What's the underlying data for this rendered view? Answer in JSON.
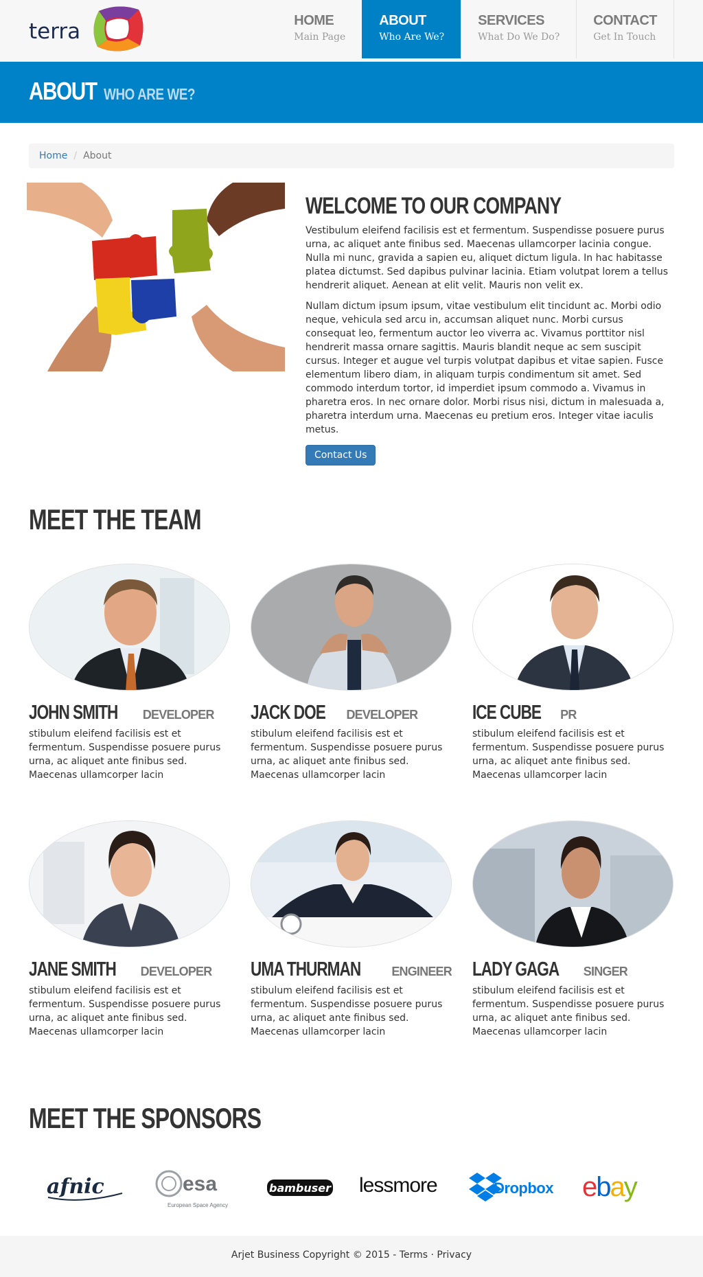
{
  "brand": {
    "logo_text": "terra"
  },
  "nav": [
    {
      "title": "HOME",
      "sub": "Main Page"
    },
    {
      "title": "ABOUT",
      "sub": "Who Are We?"
    },
    {
      "title": "SERVICES",
      "sub": "What Do We Do?"
    },
    {
      "title": "CONTACT",
      "sub": "Get In Touch"
    }
  ],
  "banner": {
    "title": "ABOUT",
    "subtitle": "WHO ARE WE?"
  },
  "breadcrumb": {
    "home": "Home",
    "separator": "/",
    "current": "About"
  },
  "about": {
    "title": "WELCOME TO OUR COMPANY",
    "p1": "Vestibulum eleifend facilisis est et fermentum. Suspendisse posuere purus urna, ac aliquet ante finibus sed. Maecenas ullamcorper lacinia congue. Nulla mi nunc, gravida a sapien eu, aliquet dictum ligula. In hac habitasse platea dictumst. Sed dapibus pulvinar lacinia. Etiam volutpat lorem a tellus hendrerit aliquet. Aenean at elit velit. Mauris non velit ex.",
    "p2": "Nullam dictum ipsum ipsum, vitae vestibulum elit tincidunt ac. Morbi odio neque, vehicula sed arcu in, accumsan aliquet nunc. Morbi cursus consequat leo, fermentum auctor leo viverra ac. Vivamus porttitor nisl hendrerit massa ornare sagittis. Mauris blandit neque ac sem suscipit cursus. Integer et augue vel turpis volutpat dapibus et vitae sapien. Fusce elementum libero diam, in aliquam turpis condimentum sit amet. Sed commodo interdum tortor, id imperdiet ipsum commodo a. Vivamus in pharetra eros. In nec ornare dolor. Morbi risus nisi, dictum in malesuada a, pharetra interdum urna. Maecenas eu pretium eros. Integer vitae iaculis metus.",
    "button": "Contact Us"
  },
  "team": {
    "title": "MEET THE TEAM",
    "members": [
      {
        "name": "JOHN SMITH",
        "role": "DEVELOPER",
        "desc": "stibulum eleifend facilisis est et fermentum. Suspendisse posuere purus urna, ac aliquet ante finibus sed. Maecenas ullamcorper lacin"
      },
      {
        "name": "JACK DOE",
        "role": "DEVELOPER",
        "desc": "stibulum eleifend facilisis est et fermentum. Suspendisse posuere purus urna, ac aliquet ante finibus sed. Maecenas ullamcorper lacin"
      },
      {
        "name": "ICE CUBE",
        "role": "PR",
        "desc": "stibulum eleifend facilisis est et fermentum. Suspendisse posuere purus urna, ac aliquet ante finibus sed. Maecenas ullamcorper lacin"
      },
      {
        "name": "JANE SMITH",
        "role": "DEVELOPER",
        "desc": "stibulum eleifend facilisis est et fermentum. Suspendisse posuere purus urna, ac aliquet ante finibus sed. Maecenas ullamcorper lacin"
      },
      {
        "name": "UMA THURMAN",
        "role": "ENGINEER",
        "desc": "stibulum eleifend facilisis est et fermentum. Suspendisse posuere purus urna, ac aliquet ante finibus sed. Maecenas ullamcorper lacin"
      },
      {
        "name": "LADY GAGA",
        "role": "SINGER",
        "desc": "stibulum eleifend facilisis est et fermentum. Suspendisse posuere purus urna, ac aliquet ante finibus sed. Maecenas ullamcorper lacin"
      }
    ]
  },
  "sponsors": {
    "title": "MEET THE SPONSORS",
    "logos": [
      "afnic",
      "esa",
      "European Space Agency",
      "bambuser",
      "lessmore",
      "Dropbox",
      "ebay"
    ]
  },
  "footer": {
    "text": "Arjet Business Copyright © 2015 - ",
    "terms": "Terms",
    "dot": " · ",
    "privacy": "Privacy"
  },
  "colors": {
    "primary": "#0082c8",
    "button": "#337ab7",
    "heading": "#333333"
  }
}
